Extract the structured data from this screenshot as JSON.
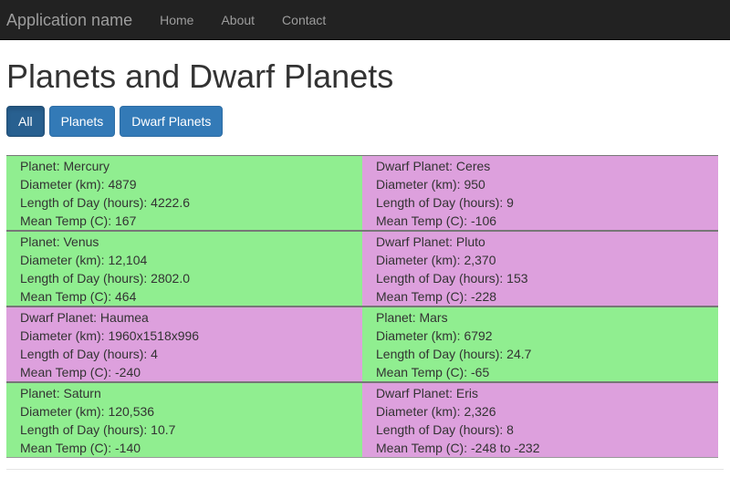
{
  "navbar": {
    "brand": "Application name",
    "links": [
      "Home",
      "About",
      "Contact"
    ]
  },
  "page": {
    "title": "Planets and Dwarf Planets",
    "filters": [
      "All",
      "Planets",
      "Dwarf Planets"
    ],
    "active_filter": "All"
  },
  "bodies": [
    {
      "type_label": "Planet: Mercury",
      "diameter": "Diameter (km): 4879",
      "day": "Length of Day (hours): 4222.6",
      "temp": "Mean Temp (C): 167",
      "kind": "planet"
    },
    {
      "type_label": "Dwarf Planet: Ceres",
      "diameter": "Diameter (km): 950",
      "day": "Length of Day (hours): 9",
      "temp": "Mean Temp (C): -106",
      "kind": "dwarf"
    },
    {
      "type_label": "Planet: Venus",
      "diameter": "Diameter (km): 12,104",
      "day": "Length of Day (hours): 2802.0",
      "temp": "Mean Temp (C): 464",
      "kind": "planet"
    },
    {
      "type_label": "Dwarf Planet: Pluto",
      "diameter": "Diameter (km): 2,370",
      "day": "Length of Day (hours): 153",
      "temp": "Mean Temp (C): -228",
      "kind": "dwarf"
    },
    {
      "type_label": "Dwarf Planet: Haumea",
      "diameter": "Diameter (km): 1960x1518x996",
      "day": "Length of Day (hours): 4",
      "temp": "Mean Temp (C): -240",
      "kind": "dwarf"
    },
    {
      "type_label": "Planet: Mars",
      "diameter": "Diameter (km): 6792",
      "day": "Length of Day (hours): 24.7",
      "temp": "Mean Temp (C): -65",
      "kind": "planet"
    },
    {
      "type_label": "Planet: Saturn",
      "diameter": "Diameter (km): 120,536",
      "day": "Length of Day (hours): 10.7",
      "temp": "Mean Temp (C): -140",
      "kind": "planet"
    },
    {
      "type_label": "Dwarf Planet: Eris",
      "diameter": "Diameter (km): 2,326",
      "day": "Length of Day (hours): 8",
      "temp": "Mean Temp (C): -248 to -232",
      "kind": "dwarf"
    }
  ],
  "colors": {
    "planet": "#90ee90",
    "dwarf": "#dda0dd",
    "navbar": "#222222",
    "button": "#337ab7"
  }
}
